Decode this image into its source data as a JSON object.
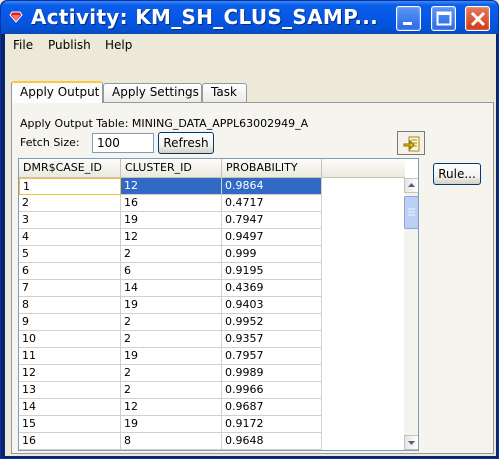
{
  "window": {
    "title": "Activity: KM_SH_CLUS_SAMP..."
  },
  "menu": {
    "file": "File",
    "publish": "Publish",
    "help": "Help"
  },
  "tabs": [
    {
      "label": "Apply Output",
      "active": true
    },
    {
      "label": "Apply Settings",
      "active": false
    },
    {
      "label": "Task",
      "active": false
    }
  ],
  "output": {
    "table_label": "Apply Output Table: MINING_DATA_APPL63002949_A",
    "fetch_label": "Fetch Size:",
    "fetch_value": "100",
    "refresh_label": "Refresh",
    "rule_label": "Rule..."
  },
  "grid": {
    "columns": [
      "DMR$CASE_ID",
      "CLUSTER_ID",
      "PROBABILITY"
    ],
    "rows": [
      [
        "1",
        "12",
        "0.9864"
      ],
      [
        "2",
        "16",
        "0.4717"
      ],
      [
        "3",
        "19",
        "0.7947"
      ],
      [
        "4",
        "12",
        "0.9497"
      ],
      [
        "5",
        "2",
        "0.999"
      ],
      [
        "6",
        "6",
        "0.9195"
      ],
      [
        "7",
        "14",
        "0.4369"
      ],
      [
        "8",
        "19",
        "0.9403"
      ],
      [
        "9",
        "2",
        "0.9952"
      ],
      [
        "10",
        "2",
        "0.9357"
      ],
      [
        "11",
        "19",
        "0.7957"
      ],
      [
        "12",
        "2",
        "0.9989"
      ],
      [
        "13",
        "2",
        "0.9966"
      ],
      [
        "14",
        "12",
        "0.9687"
      ],
      [
        "15",
        "19",
        "0.9172"
      ],
      [
        "16",
        "8",
        "0.9648"
      ]
    ],
    "selected_row": 0
  },
  "colors": {
    "titlebar": "#0656e6",
    "selection": "#316ac5",
    "tab_highlight": "#ffc83c"
  }
}
